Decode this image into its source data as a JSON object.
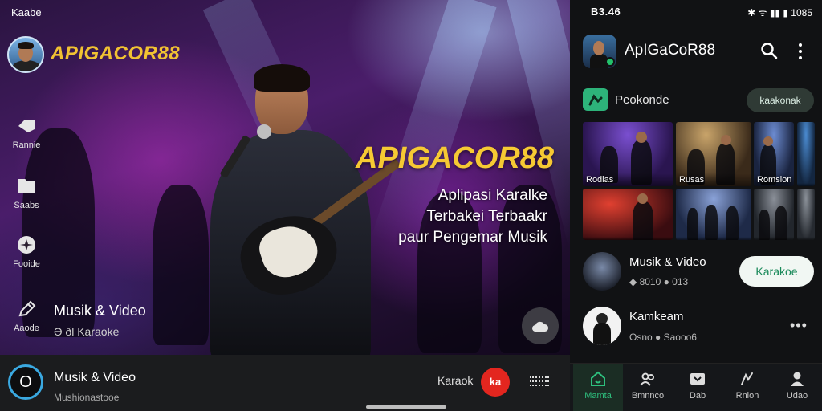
{
  "left": {
    "status_label": "Kaabe",
    "brand": "APIGACOR88",
    "side_nav": [
      {
        "label": "Rannie",
        "icon": "tag-icon"
      },
      {
        "label": "Saabs",
        "icon": "folder-icon"
      },
      {
        "label": "Fooide",
        "icon": "sparkle-icon"
      },
      {
        "label": "Aaode",
        "icon": "edit-icon"
      }
    ],
    "section_title": "Musik & Video",
    "section_sub": "Ə ðl Karaoke",
    "hero_brand": "APIGACOR88",
    "tagline": [
      "Aplipasi Karalke",
      "Terbakei Terbaakr",
      "paur Pengemar Musik"
    ],
    "fab_icon": "cloud-icon",
    "player": {
      "logo_letter": "O",
      "title": "Musik & Video",
      "subtitle": "Mushionastooe",
      "label": "Karaok",
      "rec_label": "ka"
    }
  },
  "right": {
    "time": "B3.46",
    "status_icons": "✱ ᯤ ▮▮ ▮ 1085",
    "app_title": "ApIGaCoR88",
    "rec_label": "Peokonde",
    "rec_chip": "kaakonak",
    "tiles": [
      {
        "caption": "Rodias",
        "tone": "#3b1e6e"
      },
      {
        "caption": "Rusas",
        "tone": "#4a3a28"
      },
      {
        "caption": "Romsion",
        "tone": "#22324f"
      },
      {
        "caption": "",
        "tone": "#1c3b5a"
      },
      {
        "caption": "",
        "tone": "#5a1a1a"
      },
      {
        "caption": "",
        "tone": "#2a3c5e"
      },
      {
        "caption": "",
        "tone": "#2f3338"
      },
      {
        "caption": "",
        "tone": "#3a3e44"
      }
    ],
    "items": [
      {
        "title": "Musik & Video",
        "meta": "◆ 8010 ● 013",
        "action": "Karakoe"
      },
      {
        "title": "Kamkeam",
        "meta": "Osno ● Saooo6",
        "action": "•••"
      }
    ],
    "nav": [
      {
        "label": "Mamta",
        "icon": "home-icon",
        "active": true
      },
      {
        "label": "Bmnnco",
        "icon": "people-icon",
        "active": false
      },
      {
        "label": "Dab",
        "icon": "inbox-icon",
        "active": false
      },
      {
        "label": "Rnion",
        "icon": "discover-icon",
        "active": false
      },
      {
        "label": "Udao",
        "icon": "person-icon",
        "active": false
      }
    ]
  }
}
